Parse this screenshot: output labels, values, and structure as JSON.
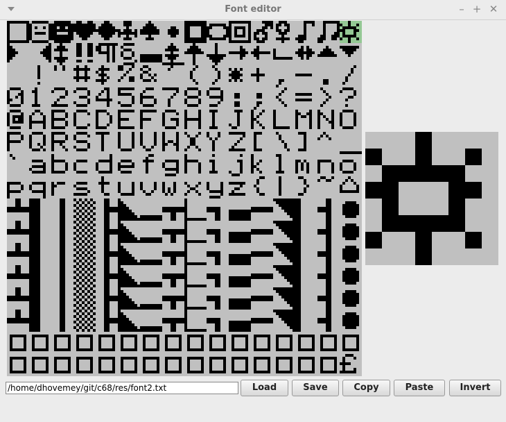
{
  "window": {
    "title": "Font editor",
    "menu_icon": "chevron-down-icon",
    "minimize_label": "–",
    "maximize_label": "+",
    "close_label": "✕"
  },
  "glyph_grid": {
    "columns": 16,
    "rows": 16,
    "selected_index": 15,
    "colors": {
      "background": "#c0c0c0",
      "ink": "#000000",
      "selected": "#94c894"
    },
    "glyphs": [
      "open-square",
      "face",
      "face-inverse",
      "heart",
      "diamond",
      "club",
      "spade",
      "dot",
      "inverse-square-hole",
      "circle",
      "inverse-circle",
      "male-sign",
      "female-sign",
      "eighth-note",
      "double-note",
      "sun",
      "right-triangle",
      "left-triangle",
      "up-down-arrow",
      "double-exclamation",
      "pilcrow",
      "section",
      "thick-bar",
      "up-down-arrow-underlined",
      "up-arrow",
      "down-arrow",
      "right-arrow",
      "left-arrow",
      "corner",
      "left-right-arrow",
      "up-triangle",
      "down-triangle",
      " ",
      "!",
      "\"",
      "#",
      "$",
      "%",
      "&",
      "'",
      "(",
      ")",
      "*",
      "+",
      ",",
      "-",
      ".",
      "/",
      "0",
      "1",
      "2",
      "3",
      "4",
      "5",
      "6",
      "7",
      "8",
      "9",
      ":",
      ";",
      "<",
      "=",
      ">",
      "?",
      "@",
      "A",
      "B",
      "C",
      "D",
      "E",
      "F",
      "G",
      "H",
      "I",
      "J",
      "K",
      "L",
      "M",
      "N",
      "O",
      "P",
      "Q",
      "R",
      "S",
      "T",
      "U",
      "V",
      "W",
      "X",
      "Y",
      "Z",
      "[",
      "\\",
      "]",
      "^",
      "_",
      "`",
      "a",
      "b",
      "c",
      "d",
      "e",
      "f",
      "g",
      "h",
      "i",
      "j",
      "k",
      "l",
      "m",
      "n",
      "o",
      "p",
      "q",
      "r",
      "s",
      "t",
      "u",
      "v",
      "w",
      "x",
      "y",
      "z",
      "{",
      "|",
      "}",
      "~",
      "house"
    ]
  },
  "preview": {
    "glyph": "sun"
  },
  "bottom": {
    "path_value": "/home/dhovemey/git/c68/res/font2.txt",
    "load_label": "Load",
    "save_label": "Save",
    "copy_label": "Copy",
    "paste_label": "Paste",
    "invert_label": "Invert"
  }
}
